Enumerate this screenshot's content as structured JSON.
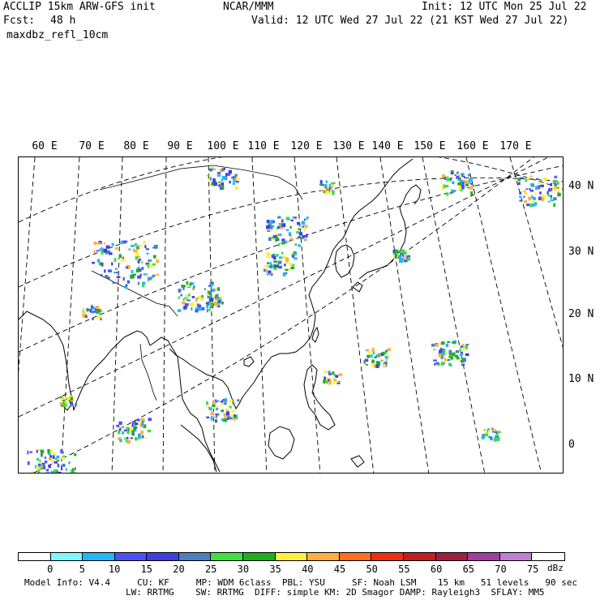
{
  "header": {
    "model_line": "ACCLIP 15km ARW-GFS init",
    "fcst_label": "Fcst:",
    "fcst_value": "48 h",
    "field_name": "maxdbz_refl_10cm",
    "center_title": "NCAR/MMM",
    "init_time": "Init: 12 UTC Mon 25 Jul 22",
    "valid_time": "Valid: 12 UTC Wed 27 Jul 22 (21 KST Wed 27 Jul 22)"
  },
  "map": {
    "lon_labels": [
      "60 E",
      "70 E",
      "80 E",
      "90 E",
      "100 E",
      "110 E",
      "120 E",
      "130 E",
      "140 E",
      "150 E",
      "160 E",
      "170 E"
    ],
    "lat_labels": [
      "40 N",
      "30 N",
      "20 N",
      "10 N",
      "0"
    ],
    "coastline_color": "#000000",
    "grid_color": "#000000"
  },
  "colorbar": {
    "unit": "dBz",
    "levels": [
      "0",
      "5",
      "10",
      "15",
      "20",
      "25",
      "30",
      "35",
      "40",
      "45",
      "50",
      "55",
      "60",
      "65",
      "70",
      "75"
    ],
    "colors": [
      "#ffffff",
      "#7ff7ff",
      "#1fb7f7",
      "#4f4ff7",
      "#3f3fdf",
      "#4f7fbf",
      "#3fdf3f",
      "#1faf1f",
      "#ffef3f",
      "#ffaf3f",
      "#ff6f1f",
      "#ef2f0f",
      "#bf1f1f",
      "#9f1f3f",
      "#9f3f9f",
      "#bf7fcf",
      "#ffffff"
    ]
  },
  "footer": {
    "line1": "Model Info: V4.4     CU: KF     MP: WDM 6class  PBL: YSU     SF: Noah LSM    15 km   51 levels   90 sec",
    "line2": "LW: RRTMG    SW: RRTMG  DIFF: simple KM: 2D Smagor DAMP: Rayleigh3  SFLAY: MM5"
  }
}
